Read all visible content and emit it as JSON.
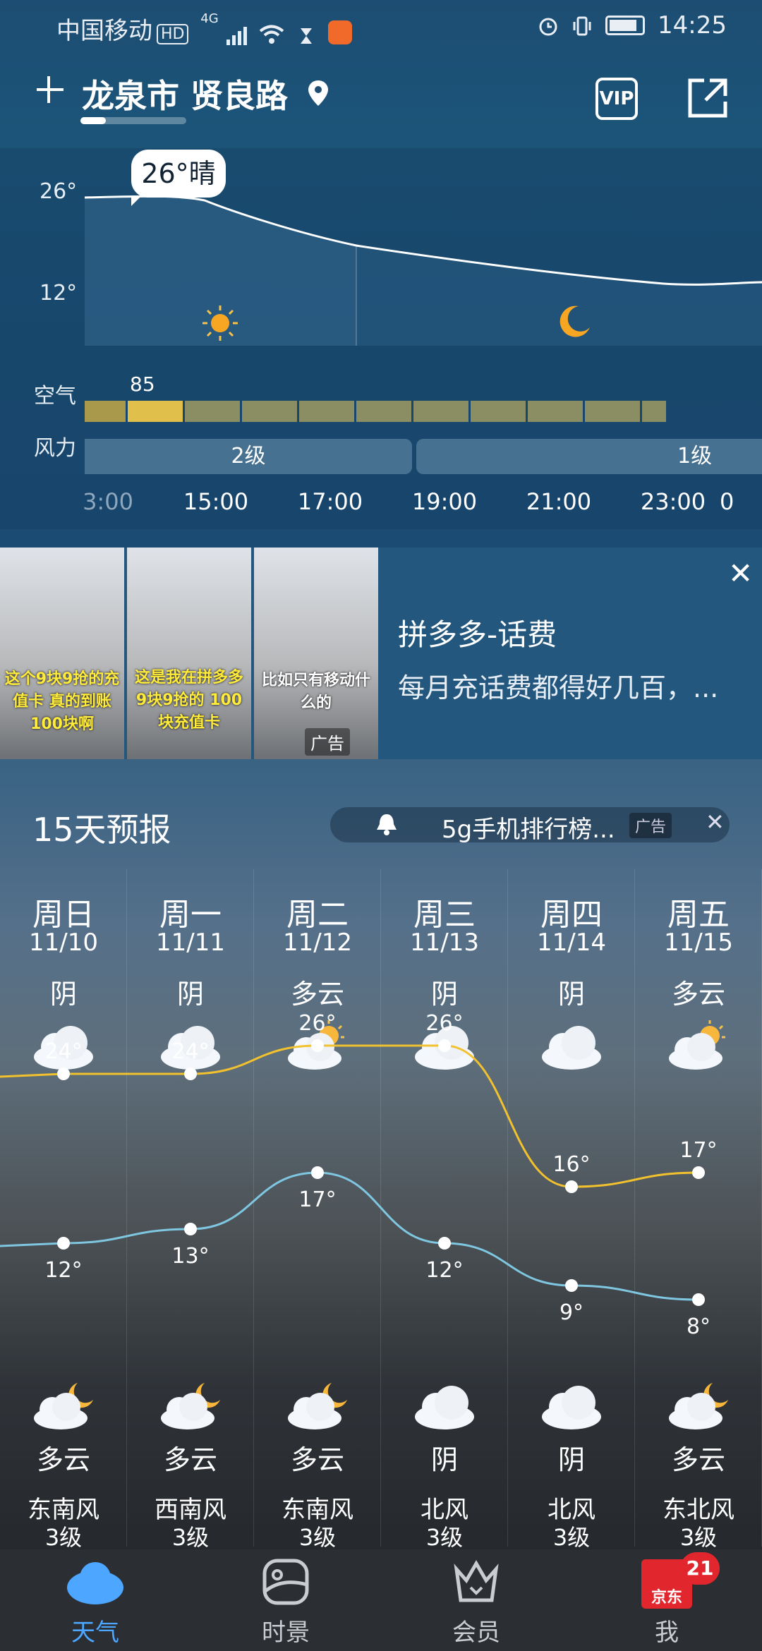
{
  "status_bar": {
    "carrier": "中国移动",
    "hd": "HD",
    "network": "4G",
    "time": "14:25"
  },
  "header": {
    "location": "龙泉市 贤良路",
    "vip_label": "VIP"
  },
  "hourly": {
    "current_bubble": "26°晴",
    "temp_ticks": [
      "26°",
      "12°"
    ],
    "aq_label": "空气",
    "aq_value": "85",
    "wind_label": "风力",
    "wind_segments": [
      "2级",
      "1级"
    ],
    "hours": [
      "3:00",
      "15:00",
      "17:00",
      "19:00",
      "21:00",
      "23:00",
      "0"
    ]
  },
  "ad": {
    "title": "拼多多-话费",
    "description": "每月充话费都得好几百，...",
    "tag": "广告",
    "captions": [
      "这个9块9抢的充值卡 真的到账100块啊",
      "这是我在拼多多 9块9抢的 100块充值卡",
      "比如只有移动什么的"
    ]
  },
  "forecast": {
    "title": "15天预报",
    "ad_text": "5g手机排行榜...",
    "ad_tag": "广告",
    "days": [
      {
        "week": "周日",
        "date": "11/10",
        "day_cond": "阴",
        "day_icon": "cloudy",
        "high": "24°",
        "low": "12°",
        "night_icon": "cloudy-moon",
        "night_cond": "多云",
        "wind": "东南风",
        "wind_level": "3级"
      },
      {
        "week": "周一",
        "date": "11/11",
        "day_cond": "阴",
        "day_icon": "cloudy",
        "high": "24°",
        "low": "13°",
        "night_icon": "cloudy-moon",
        "night_cond": "多云",
        "wind": "西南风",
        "wind_level": "3级"
      },
      {
        "week": "周二",
        "date": "11/12",
        "day_cond": "多云",
        "day_icon": "partly-sunny",
        "high": "26°",
        "low": "17°",
        "night_icon": "cloudy-moon",
        "night_cond": "多云",
        "wind": "东南风",
        "wind_level": "3级"
      },
      {
        "week": "周三",
        "date": "11/13",
        "day_cond": "阴",
        "day_icon": "cloudy",
        "high": "26°",
        "low": "12°",
        "night_icon": "cloudy",
        "night_cond": "阴",
        "wind": "北风",
        "wind_level": "3级"
      },
      {
        "week": "周四",
        "date": "11/14",
        "day_cond": "阴",
        "day_icon": "cloudy",
        "high": "16°",
        "low": "9°",
        "night_icon": "cloudy",
        "night_cond": "阴",
        "wind": "北风",
        "wind_level": "3级"
      },
      {
        "week": "周五",
        "date": "11/15",
        "day_cond": "多云",
        "day_icon": "partly-sunny",
        "high": "17°",
        "low": "8°",
        "night_icon": "cloudy-moon",
        "night_cond": "多云",
        "wind": "东北风",
        "wind_level": "3级"
      }
    ],
    "high_values": [
      24,
      24,
      26,
      26,
      16,
      17
    ],
    "low_values": [
      12,
      13,
      17,
      12,
      9,
      8
    ],
    "high_color": "#f2c12e",
    "low_color": "#7fc6e0"
  },
  "nav": {
    "items": [
      "天气",
      "时景",
      "会员",
      "我"
    ],
    "jd_label": "京东",
    "badge": "21",
    "active_color": "#4da6ff"
  }
}
